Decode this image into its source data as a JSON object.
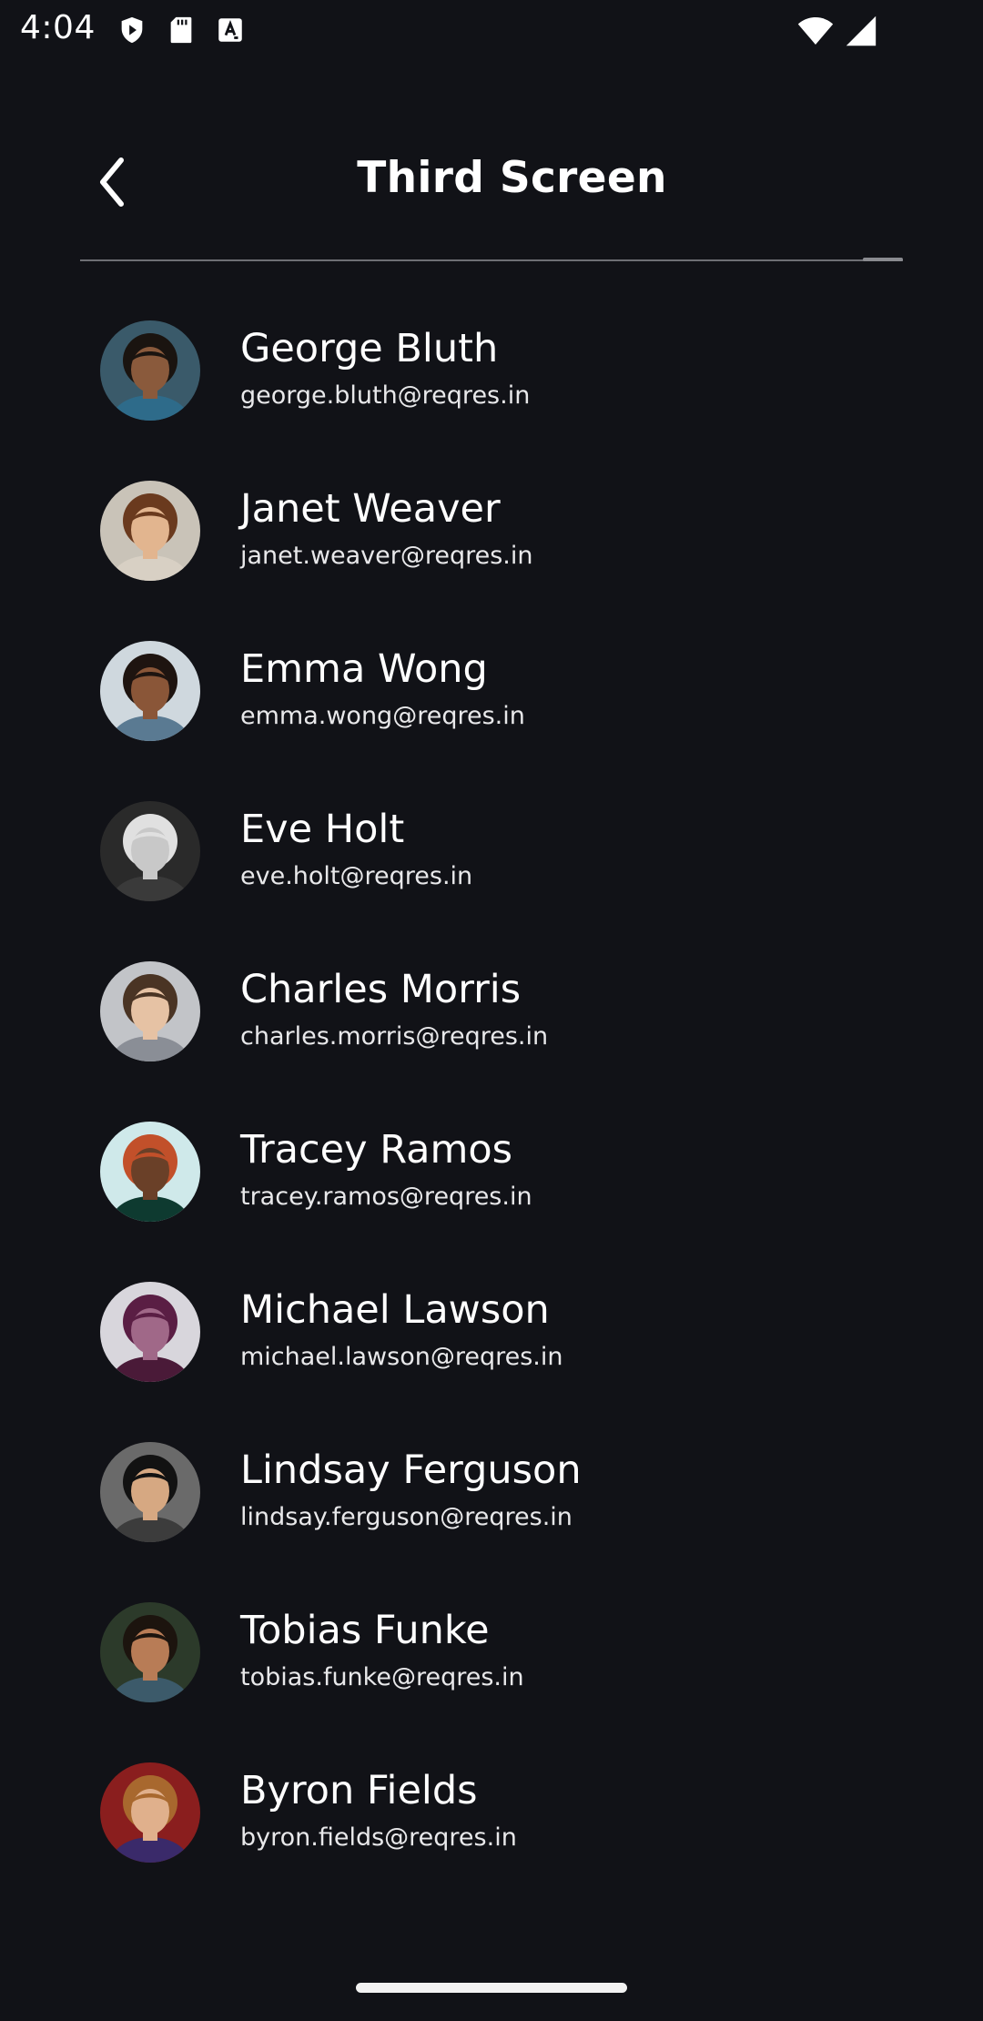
{
  "status_bar": {
    "time": "4:04",
    "left_icons": [
      "shield-play-icon",
      "sd-card-icon",
      "font-a-icon"
    ],
    "right_icons": [
      "wifi-icon",
      "signal-icon"
    ]
  },
  "app_bar": {
    "title": "Third Screen",
    "back_icon": "chevron-left-icon"
  },
  "users": [
    {
      "name": "George Bluth",
      "email": "george.bluth@reqres.in",
      "avatar_bg": "#3a5a6a",
      "skin": "#8a5a3c",
      "hair": "#1a1410",
      "shirt": "#2e6b8a"
    },
    {
      "name": "Janet Weaver",
      "email": "janet.weaver@reqres.in",
      "avatar_bg": "#c9c3b8",
      "skin": "#e2b58f",
      "hair": "#6a3a1e",
      "shirt": "#d8d0c4"
    },
    {
      "name": "Emma Wong",
      "email": "emma.wong@reqres.in",
      "avatar_bg": "#cfd8de",
      "skin": "#8a5638",
      "hair": "#1e1410",
      "shirt": "#5a7a92"
    },
    {
      "name": "Eve Holt",
      "email": "eve.holt@reqres.in",
      "avatar_bg": "#2a2a2a",
      "skin": "#c8c8c8",
      "hair": "#e0e0e0",
      "shirt": "#3a3a3a"
    },
    {
      "name": "Charles Morris",
      "email": "charles.morris@reqres.in",
      "avatar_bg": "#c2c4c8",
      "skin": "#e6c2a4",
      "hair": "#4a3424",
      "shirt": "#8a8e96"
    },
    {
      "name": "Tracey Ramos",
      "email": "tracey.ramos@reqres.in",
      "avatar_bg": "#cfe9ea",
      "skin": "#6a4028",
      "hair": "#c2502a",
      "shirt": "#0e3a30"
    },
    {
      "name": "Michael Lawson",
      "email": "michael.lawson@reqres.in",
      "avatar_bg": "#d8d6dc",
      "skin": "#a06888",
      "hair": "#5a1e44",
      "shirt": "#4a1a38"
    },
    {
      "name": "Lindsay Ferguson",
      "email": "lindsay.ferguson@reqres.in",
      "avatar_bg": "#6a6a6a",
      "skin": "#d6a882",
      "hair": "#121212",
      "shirt": "#3c3c3c"
    },
    {
      "name": "Tobias Funke",
      "email": "tobias.funke@reqres.in",
      "avatar_bg": "#2c3a2a",
      "skin": "#b87c56",
      "hair": "#1c140e",
      "shirt": "#3c5a6a"
    },
    {
      "name": "Byron Fields",
      "email": "byron.fields@reqres.in",
      "avatar_bg": "#8a1e1e",
      "skin": "#e0b08c",
      "hair": "#a8682e",
      "shirt": "#3a2a6a"
    }
  ]
}
